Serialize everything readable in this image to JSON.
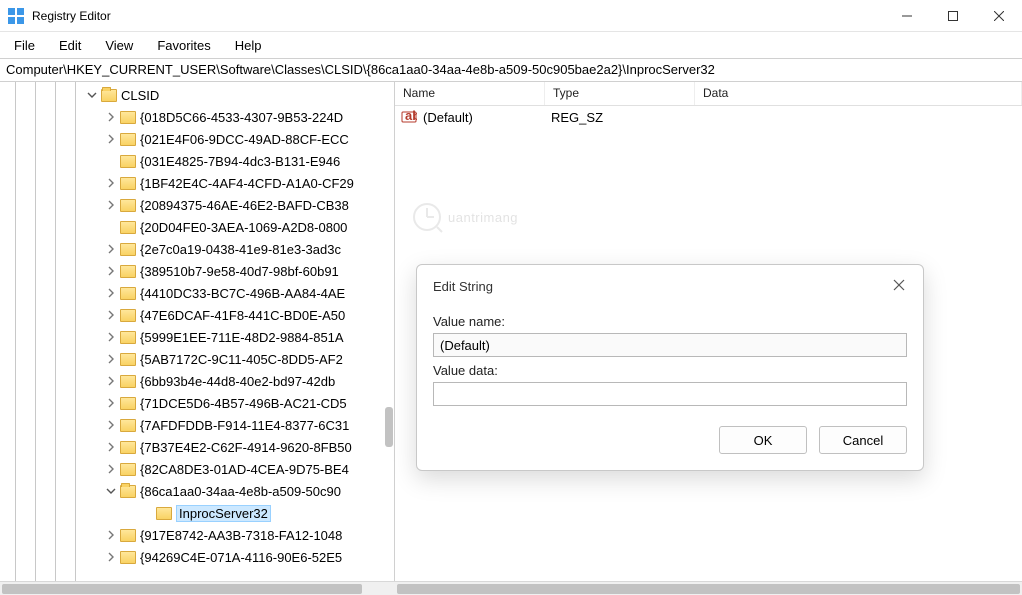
{
  "window": {
    "title": "Registry Editor"
  },
  "menu": {
    "file": "File",
    "edit": "Edit",
    "view": "View",
    "favorites": "Favorites",
    "help": "Help"
  },
  "address": "Computer\\HKEY_CURRENT_USER\\Software\\Classes\\CLSID\\{86ca1aa0-34aa-4e8b-a509-50c905bae2a2}\\InprocServer32",
  "tree": {
    "root_label": "CLSID",
    "selected_label": "InprocServer32",
    "guids": [
      "{018D5C66-4533-4307-9B53-224D",
      "{021E4F06-9DCC-49AD-88CF-ECC",
      "{031E4825-7B94-4dc3-B131-E946",
      "{1BF42E4C-4AF4-4CFD-A1A0-CF29",
      "{20894375-46AE-46E2-BAFD-CB38",
      "{20D04FE0-3AEA-1069-A2D8-0800",
      "{2e7c0a19-0438-41e9-81e3-3ad3c",
      "{389510b7-9e58-40d7-98bf-60b91",
      "{4410DC33-BC7C-496B-AA84-4AE",
      "{47E6DCAF-41F8-441C-BD0E-A50",
      "{5999E1EE-711E-48D2-9884-851A",
      "{5AB7172C-9C11-405C-8DD5-AF2",
      "{6bb93b4e-44d8-40e2-bd97-42db",
      "{71DCE5D6-4B57-496B-AC21-CD5",
      "{7AFDFDDB-F914-11E4-8377-6C31",
      "{7B37E4E2-C62F-4914-9620-8FB50",
      "{82CA8DE3-01AD-4CEA-9D75-BE4",
      "{86ca1aa0-34aa-4e8b-a509-50c90",
      "{917E8742-AA3B-7318-FA12-1048",
      "{94269C4E-071A-4116-90E6-52E5"
    ]
  },
  "list": {
    "columns": {
      "name": "Name",
      "type": "Type",
      "data": "Data"
    },
    "row": {
      "name": "(Default)",
      "type": "REG_SZ",
      "data": ""
    }
  },
  "dialog": {
    "title": "Edit String",
    "value_name_label": "Value name:",
    "value_name": "(Default)",
    "value_data_label": "Value data:",
    "value_data": "",
    "ok": "OK",
    "cancel": "Cancel"
  },
  "watermark": "uantrimang"
}
